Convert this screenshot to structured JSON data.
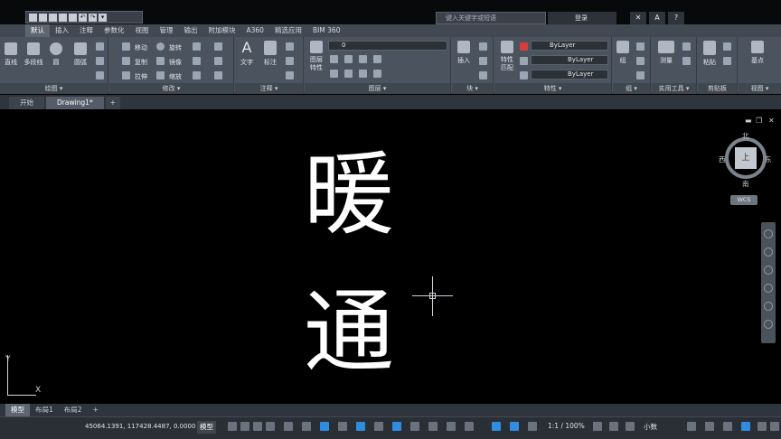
{
  "app": {
    "search_placeholder": "键入关键字或短语",
    "login_label": "登录"
  },
  "ribbon": {
    "tabs": [
      "默认",
      "插入",
      "注释",
      "参数化",
      "视图",
      "管理",
      "输出",
      "附加模块",
      "A360",
      "精选应用",
      "BIM 360"
    ],
    "active_tab": "默认",
    "panels": {
      "draw": {
        "title": "绘图 ▾",
        "line": "直线",
        "polyline": "多段线",
        "circle": "圆",
        "arc": "圆弧"
      },
      "modify": {
        "title": "修改 ▾",
        "move": "移动",
        "rotate": "旋转",
        "copy": "复制",
        "mirror": "镜像",
        "stretch": "拉伸",
        "scale": "缩放"
      },
      "annotation": {
        "title": "注释 ▾",
        "text": "文字",
        "dimension": "标注"
      },
      "layers": {
        "title": "图层 ▾",
        "layer_props": "图层\n特性",
        "current_layer": "0"
      },
      "block": {
        "title": "块 ▾",
        "insert": "插入"
      },
      "properties": {
        "title": "特性 ▾",
        "match": "特性\n匹配",
        "color": "ByLayer",
        "linetype": "ByLayer",
        "lineweight": "ByLayer"
      },
      "groups": {
        "title": "组 ▾",
        "group": "组"
      },
      "utilities": {
        "title": "实用工具 ▾",
        "measure": "测量"
      },
      "clipboard": {
        "title": "剪贴板",
        "paste": "粘贴"
      },
      "view": {
        "title": "视图 ▾",
        "base": "基点"
      }
    }
  },
  "doc_tabs": [
    "开始",
    "Drawing1*"
  ],
  "active_doc": "Drawing1*",
  "canvas": {
    "text_lines": [
      "暖",
      "通"
    ]
  },
  "viewcube": {
    "north": "北",
    "south": "南",
    "east": "东",
    "west": "西",
    "face": "上",
    "wcs": "WCS"
  },
  "ucs": {
    "x": "X",
    "y": "Y"
  },
  "layout_tabs": [
    "模型",
    "布局1",
    "布局2"
  ],
  "active_layout": "模型",
  "status_bar": {
    "coordinates": "45064.1391, 117428.4487, 0.0000",
    "model": "模型",
    "scale": "1:1 / 100%",
    "units": "小数"
  }
}
